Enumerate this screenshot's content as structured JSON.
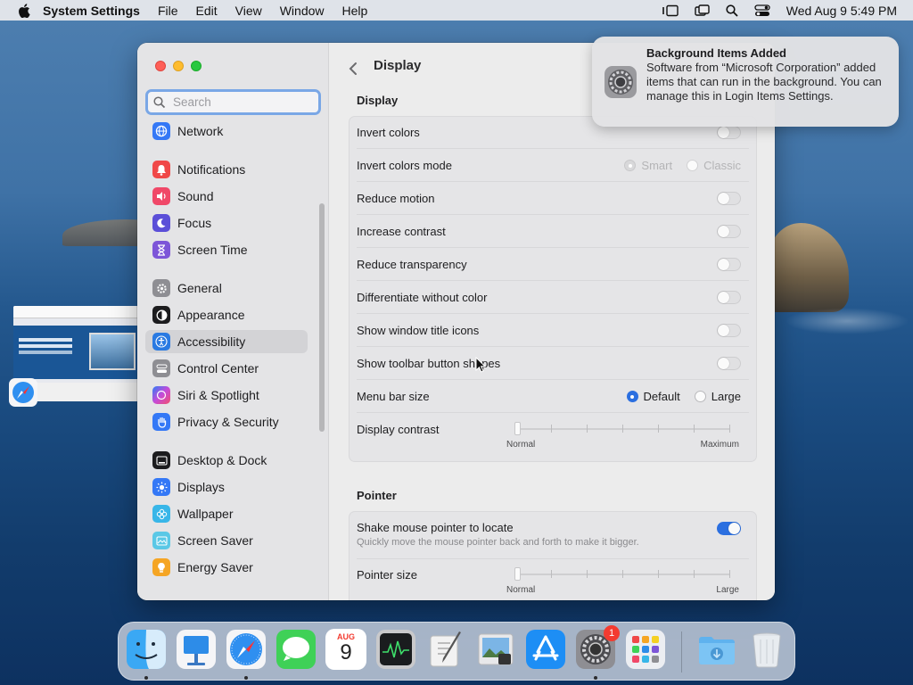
{
  "menubar": {
    "app_name": "System Settings",
    "menus": [
      "File",
      "Edit",
      "View",
      "Window",
      "Help"
    ],
    "datetime": "Wed Aug 9  5:49 PM"
  },
  "window": {
    "search_placeholder": "Search",
    "sidebar": {
      "items": [
        {
          "label": "Network",
          "icon": "globe-icon",
          "color": "#3478f6"
        },
        {
          "label": "Notifications",
          "icon": "bell-icon",
          "color": "#f04848"
        },
        {
          "label": "Sound",
          "icon": "speaker-icon",
          "color": "#f04868"
        },
        {
          "label": "Focus",
          "icon": "moon-icon",
          "color": "#5b4fd8"
        },
        {
          "label": "Screen Time",
          "icon": "hourglass-icon",
          "color": "#7d55d8"
        },
        {
          "label": "General",
          "icon": "gear-icon",
          "color": "#8e8e93"
        },
        {
          "label": "Appearance",
          "icon": "appearance-icon",
          "color": "#1c1c1e"
        },
        {
          "label": "Accessibility",
          "icon": "accessibility-icon",
          "color": "#2a7ae2"
        },
        {
          "label": "Control Center",
          "icon": "control-center-icon",
          "color": "#8e8e93"
        },
        {
          "label": "Siri & Spotlight",
          "icon": "siri-icon",
          "color": "#c64bd8"
        },
        {
          "label": "Privacy & Security",
          "icon": "hand-icon",
          "color": "#3478f6"
        },
        {
          "label": "Desktop & Dock",
          "icon": "dock-icon",
          "color": "#1c1c1e"
        },
        {
          "label": "Displays",
          "icon": "sun-icon",
          "color": "#3478f6"
        },
        {
          "label": "Wallpaper",
          "icon": "flower-icon",
          "color": "#38b6e8"
        },
        {
          "label": "Screen Saver",
          "icon": "screensaver-icon",
          "color": "#5ac8e6"
        },
        {
          "label": "Energy Saver",
          "icon": "bulb-icon",
          "color": "#f5a524"
        }
      ],
      "active": "Accessibility"
    },
    "main": {
      "title": "Display",
      "display_section": "Display",
      "rows": {
        "invert_colors": "Invert colors",
        "invert_colors_mode": "Invert colors mode",
        "invert_mode_options": [
          "Smart",
          "Classic"
        ],
        "reduce_motion": "Reduce motion",
        "increase_contrast": "Increase contrast",
        "reduce_transparency": "Reduce transparency",
        "differentiate": "Differentiate without color",
        "window_title_icons": "Show window title icons",
        "toolbar_shapes": "Show toolbar button shapes",
        "menu_bar_size": "Menu bar size",
        "menu_bar_options": [
          "Default",
          "Large"
        ],
        "display_contrast": "Display contrast",
        "contrast_min": "Normal",
        "contrast_max": "Maximum"
      },
      "pointer_section": "Pointer",
      "pointer": {
        "shake_label": "Shake mouse pointer to locate",
        "shake_desc": "Quickly move the mouse pointer back and forth to make it bigger.",
        "size_label": "Pointer size",
        "size_min": "Normal",
        "size_max": "Large"
      }
    }
  },
  "notification": {
    "title": "Background Items Added",
    "body": "Software from “Microsoft Corporation” added items that can run in the background. You can manage this in Login Items Settings."
  },
  "dock": {
    "apps": [
      "finder-icon",
      "keynote-icon",
      "safari-icon",
      "messages-icon",
      "calendar-icon",
      "activity-monitor-icon",
      "script-editor-icon",
      "preview-icon",
      "app-store-icon",
      "system-settings-icon",
      "launchpad-icon",
      "downloads-folder-icon",
      "trash-icon"
    ],
    "calendar_month": "AUG",
    "calendar_day": "9",
    "settings_badge": "1"
  }
}
